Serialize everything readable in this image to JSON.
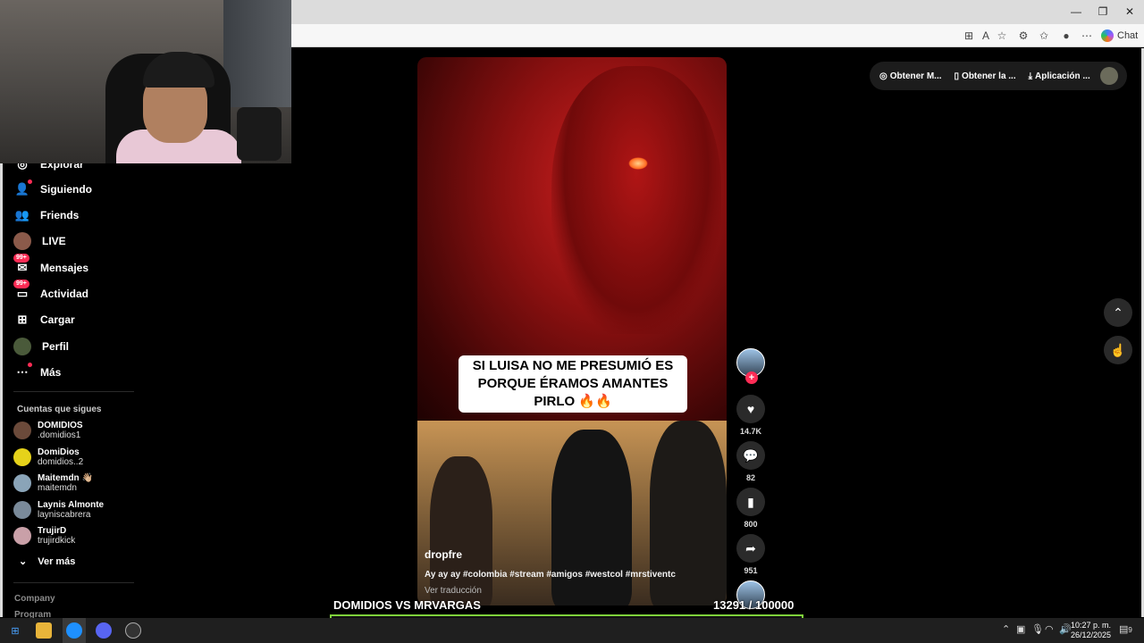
{
  "browser": {
    "chat_label": "Chat"
  },
  "sidebar": {
    "partial_item": "Explorar",
    "items": [
      {
        "label": "Siguiendo",
        "icon": "following-icon"
      },
      {
        "label": "Friends",
        "icon": "friends-icon"
      },
      {
        "label": "LIVE",
        "icon": "live-icon"
      },
      {
        "label": "Mensajes",
        "icon": "messages-icon",
        "badge": "99+"
      },
      {
        "label": "Actividad",
        "icon": "activity-icon",
        "badge": "99+"
      },
      {
        "label": "Cargar",
        "icon": "upload-icon"
      },
      {
        "label": "Perfil",
        "icon": "profile-icon"
      },
      {
        "label": "Más",
        "icon": "more-icon"
      }
    ],
    "following_title": "Cuentas que sigues",
    "accounts": [
      {
        "name": "DOMIDIOS",
        "user": ".domidios1",
        "color": "#6b4a3a"
      },
      {
        "name": "DomiDios",
        "user": "domidios..2",
        "color": "#e6d21a"
      },
      {
        "name": "Maitemdn 👋🏼",
        "user": "maitemdn",
        "color": "#8aa4b8"
      },
      {
        "name": "Laynis Almonte",
        "user": "layniscabrera",
        "color": "#7a8a9a"
      },
      {
        "name": "TrujirD",
        "user": "trujirdkick",
        "color": "#c9a0a8"
      }
    ],
    "see_more": "Ver más",
    "footer": [
      "Company",
      "Program"
    ]
  },
  "video": {
    "caption": "SI LUISA NO ME PRESUMIÓ ES PORQUE ÉRAMOS AMANTES PIRLO 🔥🔥",
    "author": "dropfre",
    "description": "Ay ay ay #colombia #stream #amigos #westcol #mrstiventc",
    "translate": "Ver traducción"
  },
  "actions": {
    "likes": "14.7K",
    "comments": "82",
    "saves": "800",
    "shares": "951"
  },
  "top_bar": {
    "pill1": "Obtener M...",
    "pill2": "Obtener la ...",
    "pill3": "Aplicación ..."
  },
  "overlay": {
    "title": "DOMIDIOS VS MRVARGAS",
    "count": "13291  / 100000",
    "progress": 0.1329,
    "bar_color": "#7fd13b"
  },
  "taskbar": {
    "time": "10:27 p. m.",
    "date": "26/12/2025",
    "notif_count": "9"
  }
}
